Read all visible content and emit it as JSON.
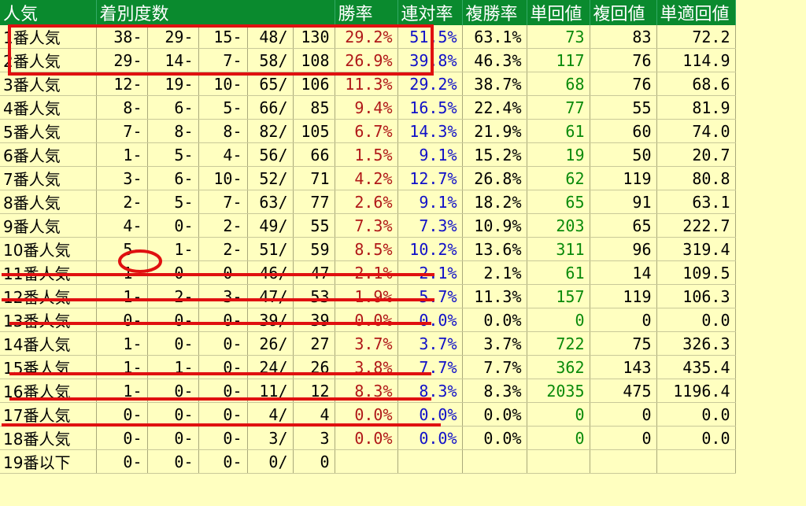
{
  "headers": {
    "popularity": "人気",
    "placings": "着別度数",
    "win_rate": "勝率",
    "quinella_rate": "連対率",
    "place_rate": "複勝率",
    "win_return": "単回値",
    "place_return": "複回値",
    "win_adj_return": "単適回値"
  },
  "rows": [
    {
      "label": "1番人気",
      "p1": "38-",
      "p2": "29-",
      "p3": "15-",
      "p4": "48/",
      "total": "130",
      "win": "29.2%",
      "ren": "51.5%",
      "fuku": "63.1%",
      "tan": "73",
      "fukuret": "83",
      "adj": "72.2"
    },
    {
      "label": "2番人気",
      "p1": "29-",
      "p2": "14-",
      "p3": "7-",
      "p4": "58/",
      "total": "108",
      "win": "26.9%",
      "ren": "39.8%",
      "fuku": "46.3%",
      "tan": "117",
      "fukuret": "76",
      "adj": "114.9"
    },
    {
      "label": "3番人気",
      "p1": "12-",
      "p2": "19-",
      "p3": "10-",
      "p4": "65/",
      "total": "106",
      "win": "11.3%",
      "ren": "29.2%",
      "fuku": "38.7%",
      "tan": "68",
      "fukuret": "76",
      "adj": "68.6"
    },
    {
      "label": "4番人気",
      "p1": "8-",
      "p2": "6-",
      "p3": "5-",
      "p4": "66/",
      "total": "85",
      "win": "9.4%",
      "ren": "16.5%",
      "fuku": "22.4%",
      "tan": "77",
      "fukuret": "55",
      "adj": "81.9"
    },
    {
      "label": "5番人気",
      "p1": "7-",
      "p2": "8-",
      "p3": "8-",
      "p4": "82/",
      "total": "105",
      "win": "6.7%",
      "ren": "14.3%",
      "fuku": "21.9%",
      "tan": "61",
      "fukuret": "60",
      "adj": "74.0"
    },
    {
      "label": "6番人気",
      "p1": "1-",
      "p2": "5-",
      "p3": "4-",
      "p4": "56/",
      "total": "66",
      "win": "1.5%",
      "ren": "9.1%",
      "fuku": "15.2%",
      "tan": "19",
      "fukuret": "50",
      "adj": "20.7"
    },
    {
      "label": "7番人気",
      "p1": "3-",
      "p2": "6-",
      "p3": "10-",
      "p4": "52/",
      "total": "71",
      "win": "4.2%",
      "ren": "12.7%",
      "fuku": "26.8%",
      "tan": "62",
      "fukuret": "119",
      "adj": "80.8"
    },
    {
      "label": "8番人気",
      "p1": "2-",
      "p2": "5-",
      "p3": "7-",
      "p4": "63/",
      "total": "77",
      "win": "2.6%",
      "ren": "9.1%",
      "fuku": "18.2%",
      "tan": "65",
      "fukuret": "91",
      "adj": "63.1"
    },
    {
      "label": "9番人気",
      "p1": "4-",
      "p2": "0-",
      "p3": "2-",
      "p4": "49/",
      "total": "55",
      "win": "7.3%",
      "ren": "7.3%",
      "fuku": "10.9%",
      "tan": "203",
      "fukuret": "65",
      "adj": "222.7"
    },
    {
      "label": "10番人気",
      "p1": "5-",
      "p2": "1-",
      "p3": "2-",
      "p4": "51/",
      "total": "59",
      "win": "8.5%",
      "ren": "10.2%",
      "fuku": "13.6%",
      "tan": "311",
      "fukuret": "96",
      "adj": "319.4"
    },
    {
      "label": "11番人気",
      "p1": "1-",
      "p2": "0-",
      "p3": "0-",
      "p4": "46/",
      "total": "47",
      "win": "2.1%",
      "ren": "2.1%",
      "fuku": "2.1%",
      "tan": "61",
      "fukuret": "14",
      "adj": "109.5"
    },
    {
      "label": "12番人気",
      "p1": "1-",
      "p2": "2-",
      "p3": "3-",
      "p4": "47/",
      "total": "53",
      "win": "1.9%",
      "ren": "5.7%",
      "fuku": "11.3%",
      "tan": "157",
      "fukuret": "119",
      "adj": "106.3"
    },
    {
      "label": "13番人気",
      "p1": "0-",
      "p2": "0-",
      "p3": "0-",
      "p4": "39/",
      "total": "39",
      "win": "0.0%",
      "ren": "0.0%",
      "fuku": "0.0%",
      "tan": "0",
      "fukuret": "0",
      "adj": "0.0"
    },
    {
      "label": "14番人気",
      "p1": "1-",
      "p2": "0-",
      "p3": "0-",
      "p4": "26/",
      "total": "27",
      "win": "3.7%",
      "ren": "3.7%",
      "fuku": "3.7%",
      "tan": "722",
      "fukuret": "75",
      "adj": "326.3"
    },
    {
      "label": "15番人気",
      "p1": "1-",
      "p2": "1-",
      "p3": "0-",
      "p4": "24/",
      "total": "26",
      "win": "3.8%",
      "ren": "7.7%",
      "fuku": "7.7%",
      "tan": "362",
      "fukuret": "143",
      "adj": "435.4"
    },
    {
      "label": "16番人気",
      "p1": "1-",
      "p2": "0-",
      "p3": "0-",
      "p4": "11/",
      "total": "12",
      "win": "8.3%",
      "ren": "8.3%",
      "fuku": "8.3%",
      "tan": "2035",
      "fukuret": "475",
      "adj": "1196.4"
    },
    {
      "label": "17番人気",
      "p1": "0-",
      "p2": "0-",
      "p3": "0-",
      "p4": "4/",
      "total": "4",
      "win": "0.0%",
      "ren": "0.0%",
      "fuku": "0.0%",
      "tan": "0",
      "fukuret": "0",
      "adj": "0.0"
    },
    {
      "label": "18番人気",
      "p1": "0-",
      "p2": "0-",
      "p3": "0-",
      "p4": "3/",
      "total": "3",
      "win": "0.0%",
      "ren": "0.0%",
      "fuku": "0.0%",
      "tan": "0",
      "fukuret": "0",
      "adj": "0.0"
    },
    {
      "label": "19番以下",
      "p1": "0-",
      "p2": "0-",
      "p3": "0-",
      "p4": "0/",
      "total": "0",
      "win": "",
      "ren": "",
      "fuku": "",
      "tan": "",
      "fukuret": "",
      "adj": ""
    }
  ],
  "colors": {
    "header_bg": "#0a8a2e",
    "body_bg": "#ffffc0",
    "win_rate_text": "#b01818",
    "quinella_text": "#1010c8",
    "win_return_text": "#0a8a0a",
    "annotation_red": "#e01010"
  }
}
